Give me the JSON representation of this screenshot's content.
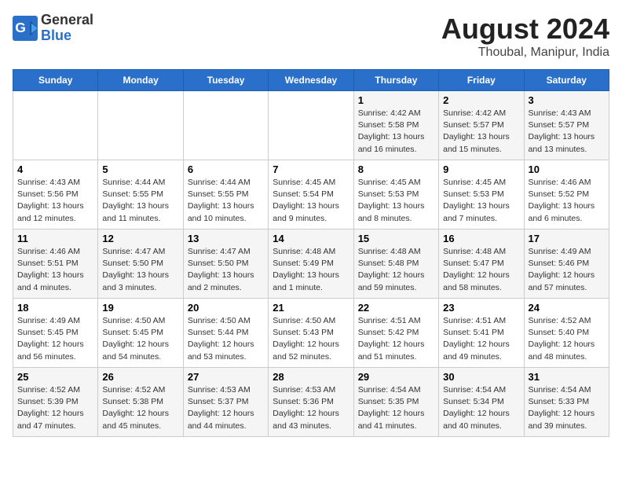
{
  "header": {
    "logo_general": "General",
    "logo_blue": "Blue",
    "title": "August 2024",
    "subtitle": "Thoubal, Manipur, India"
  },
  "days_of_week": [
    "Sunday",
    "Monday",
    "Tuesday",
    "Wednesday",
    "Thursday",
    "Friday",
    "Saturday"
  ],
  "weeks": [
    [
      {
        "day": "",
        "info": ""
      },
      {
        "day": "",
        "info": ""
      },
      {
        "day": "",
        "info": ""
      },
      {
        "day": "",
        "info": ""
      },
      {
        "day": "1",
        "info": "Sunrise: 4:42 AM\nSunset: 5:58 PM\nDaylight: 13 hours\nand 16 minutes."
      },
      {
        "day": "2",
        "info": "Sunrise: 4:42 AM\nSunset: 5:57 PM\nDaylight: 13 hours\nand 15 minutes."
      },
      {
        "day": "3",
        "info": "Sunrise: 4:43 AM\nSunset: 5:57 PM\nDaylight: 13 hours\nand 13 minutes."
      }
    ],
    [
      {
        "day": "4",
        "info": "Sunrise: 4:43 AM\nSunset: 5:56 PM\nDaylight: 13 hours\nand 12 minutes."
      },
      {
        "day": "5",
        "info": "Sunrise: 4:44 AM\nSunset: 5:55 PM\nDaylight: 13 hours\nand 11 minutes."
      },
      {
        "day": "6",
        "info": "Sunrise: 4:44 AM\nSunset: 5:55 PM\nDaylight: 13 hours\nand 10 minutes."
      },
      {
        "day": "7",
        "info": "Sunrise: 4:45 AM\nSunset: 5:54 PM\nDaylight: 13 hours\nand 9 minutes."
      },
      {
        "day": "8",
        "info": "Sunrise: 4:45 AM\nSunset: 5:53 PM\nDaylight: 13 hours\nand 8 minutes."
      },
      {
        "day": "9",
        "info": "Sunrise: 4:45 AM\nSunset: 5:53 PM\nDaylight: 13 hours\nand 7 minutes."
      },
      {
        "day": "10",
        "info": "Sunrise: 4:46 AM\nSunset: 5:52 PM\nDaylight: 13 hours\nand 6 minutes."
      }
    ],
    [
      {
        "day": "11",
        "info": "Sunrise: 4:46 AM\nSunset: 5:51 PM\nDaylight: 13 hours\nand 4 minutes."
      },
      {
        "day": "12",
        "info": "Sunrise: 4:47 AM\nSunset: 5:50 PM\nDaylight: 13 hours\nand 3 minutes."
      },
      {
        "day": "13",
        "info": "Sunrise: 4:47 AM\nSunset: 5:50 PM\nDaylight: 13 hours\nand 2 minutes."
      },
      {
        "day": "14",
        "info": "Sunrise: 4:48 AM\nSunset: 5:49 PM\nDaylight: 13 hours\nand 1 minute."
      },
      {
        "day": "15",
        "info": "Sunrise: 4:48 AM\nSunset: 5:48 PM\nDaylight: 12 hours\nand 59 minutes."
      },
      {
        "day": "16",
        "info": "Sunrise: 4:48 AM\nSunset: 5:47 PM\nDaylight: 12 hours\nand 58 minutes."
      },
      {
        "day": "17",
        "info": "Sunrise: 4:49 AM\nSunset: 5:46 PM\nDaylight: 12 hours\nand 57 minutes."
      }
    ],
    [
      {
        "day": "18",
        "info": "Sunrise: 4:49 AM\nSunset: 5:45 PM\nDaylight: 12 hours\nand 56 minutes."
      },
      {
        "day": "19",
        "info": "Sunrise: 4:50 AM\nSunset: 5:45 PM\nDaylight: 12 hours\nand 54 minutes."
      },
      {
        "day": "20",
        "info": "Sunrise: 4:50 AM\nSunset: 5:44 PM\nDaylight: 12 hours\nand 53 minutes."
      },
      {
        "day": "21",
        "info": "Sunrise: 4:50 AM\nSunset: 5:43 PM\nDaylight: 12 hours\nand 52 minutes."
      },
      {
        "day": "22",
        "info": "Sunrise: 4:51 AM\nSunset: 5:42 PM\nDaylight: 12 hours\nand 51 minutes."
      },
      {
        "day": "23",
        "info": "Sunrise: 4:51 AM\nSunset: 5:41 PM\nDaylight: 12 hours\nand 49 minutes."
      },
      {
        "day": "24",
        "info": "Sunrise: 4:52 AM\nSunset: 5:40 PM\nDaylight: 12 hours\nand 48 minutes."
      }
    ],
    [
      {
        "day": "25",
        "info": "Sunrise: 4:52 AM\nSunset: 5:39 PM\nDaylight: 12 hours\nand 47 minutes."
      },
      {
        "day": "26",
        "info": "Sunrise: 4:52 AM\nSunset: 5:38 PM\nDaylight: 12 hours\nand 45 minutes."
      },
      {
        "day": "27",
        "info": "Sunrise: 4:53 AM\nSunset: 5:37 PM\nDaylight: 12 hours\nand 44 minutes."
      },
      {
        "day": "28",
        "info": "Sunrise: 4:53 AM\nSunset: 5:36 PM\nDaylight: 12 hours\nand 43 minutes."
      },
      {
        "day": "29",
        "info": "Sunrise: 4:54 AM\nSunset: 5:35 PM\nDaylight: 12 hours\nand 41 minutes."
      },
      {
        "day": "30",
        "info": "Sunrise: 4:54 AM\nSunset: 5:34 PM\nDaylight: 12 hours\nand 40 minutes."
      },
      {
        "day": "31",
        "info": "Sunrise: 4:54 AM\nSunset: 5:33 PM\nDaylight: 12 hours\nand 39 minutes."
      }
    ]
  ]
}
